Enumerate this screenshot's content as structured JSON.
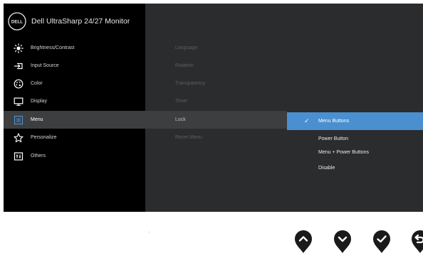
{
  "brand": {
    "logo_text": "DELL",
    "title": "Dell UltraSharp 24/27 Monitor"
  },
  "main_menu": [
    {
      "label": "Brightness/Contrast",
      "icon": "brightness-icon"
    },
    {
      "label": "Input Source",
      "icon": "input-source-icon"
    },
    {
      "label": "Color",
      "icon": "color-palette-icon"
    },
    {
      "label": "Display",
      "icon": "display-icon"
    },
    {
      "label": "Menu",
      "icon": "menu-icon",
      "selected": true
    },
    {
      "label": "Personalize",
      "icon": "star-icon"
    },
    {
      "label": "Others",
      "icon": "others-icon"
    }
  ],
  "submenu": [
    {
      "label": "Language"
    },
    {
      "label": "Rotation"
    },
    {
      "label": "Transparency"
    },
    {
      "label": "Timer"
    },
    {
      "label": "Lock",
      "selected": true
    },
    {
      "label": "Reset Menu"
    }
  ],
  "lock_options": [
    {
      "label": "Menu Buttons",
      "selected": true,
      "check": "✓"
    },
    {
      "label": "Power Button"
    },
    {
      "label": "Menu + Power Buttons"
    },
    {
      "label": "Disable"
    }
  ],
  "nav_keys": [
    {
      "icon": "chevron-up-icon"
    },
    {
      "icon": "chevron-down-icon"
    },
    {
      "icon": "check-icon"
    },
    {
      "icon": "back-icon"
    }
  ],
  "colors": {
    "highlight": "#4a8fd0",
    "panel": "#2b2c2d",
    "sidebar": "#000000",
    "selected_row": "#3d3e40"
  }
}
